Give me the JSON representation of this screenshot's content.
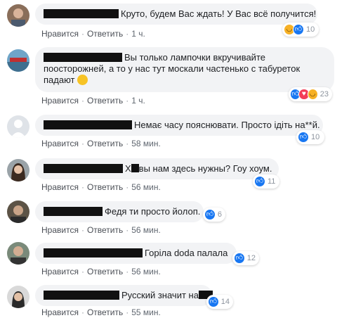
{
  "comments": [
    {
      "text": "Круто, будем Вас ждать! У Вас всё получится!",
      "like_label": "Нравится",
      "reply_label": "Ответить",
      "time": "1 ч.",
      "reaction_count": "10"
    },
    {
      "text": "Вы только лампочки вкручивайте поосторожней, а то у нас тут москали частенько с табуреток падают",
      "like_label": "Нравится",
      "reply_label": "Ответить",
      "time": "1 ч.",
      "reaction_count": "23"
    },
    {
      "text": "Немає часу пояснювати. Просто ідіть на**й.",
      "like_label": "Нравится",
      "reply_label": "Ответить",
      "time": "58 мин.",
      "reaction_count": "10"
    },
    {
      "text": "вы нам здесь нужны? Гоу хоум.",
      "text_prefix": "Х",
      "like_label": "Нравится",
      "reply_label": "Ответить",
      "time": "56 мин.",
      "reaction_count": "11"
    },
    {
      "text": "Федя ти просто йолоп.",
      "like_label": "Нравится",
      "reply_label": "Ответить",
      "time": "56 мин.",
      "reaction_count": "6"
    },
    {
      "text": "Горіла doda палала",
      "like_label": "Нравится",
      "reply_label": "Ответить",
      "time": "56 мин.",
      "reaction_count": "12"
    },
    {
      "text": "Русский значит на",
      "like_label": "Нравится",
      "reply_label": "Ответить",
      "time": "55 мин.",
      "reaction_count": "14"
    }
  ],
  "colors": {
    "bubble": "#f2f3f5",
    "like_blue": "#1877f2",
    "love_red": "#f33e58",
    "haha_yellow": "#f7b125",
    "meta_text": "#606770"
  }
}
